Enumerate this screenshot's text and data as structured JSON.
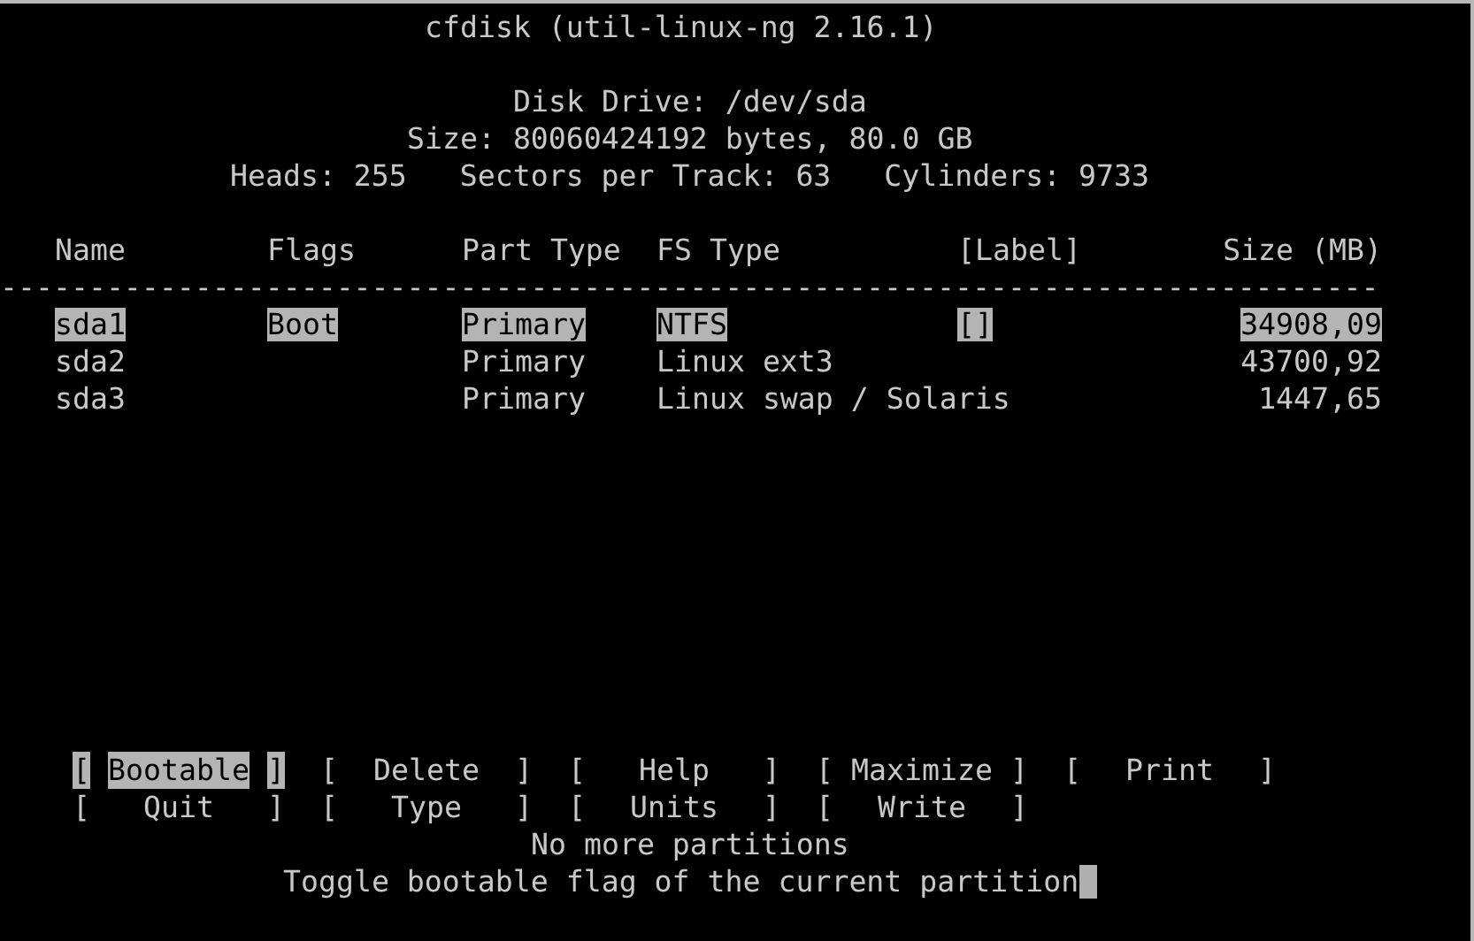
{
  "title": "cfdisk (util-linux-ng 2.16.1)",
  "disk": {
    "drive": "Disk Drive: /dev/sda",
    "size": "Size: 80060424192 bytes, 80.0 GB",
    "geometry": "Heads: 255   Sectors per Track: 63   Cylinders: 9733"
  },
  "table": {
    "columns": [
      "Name",
      "Flags",
      "Part Type",
      "FS Type",
      "[Label]",
      "Size (MB)"
    ],
    "separator": "------------------------------------------------------------------------------",
    "rows": [
      {
        "name": "sda1",
        "flags": "Boot",
        "part_type": "Primary",
        "fs_type": "NTFS",
        "label": "[]",
        "size": "34908,09",
        "selected": true
      },
      {
        "name": "sda2",
        "flags": "",
        "part_type": "Primary",
        "fs_type": "Linux ext3",
        "label": "",
        "size": "43700,92",
        "selected": false
      },
      {
        "name": "sda3",
        "flags": "",
        "part_type": "Primary",
        "fs_type": "Linux swap / Solaris",
        "label": "",
        "size": "1447,65",
        "selected": false
      }
    ]
  },
  "menu": [
    {
      "open": "[",
      "label": "Bootable",
      "close": "]",
      "selected": true
    },
    {
      "open": "[",
      "label": "Delete",
      "close": "]",
      "selected": false
    },
    {
      "open": "[",
      "label": "Help",
      "close": "]",
      "selected": false
    },
    {
      "open": "[",
      "label": "Maximize",
      "close": "]",
      "selected": false
    },
    {
      "open": "[",
      "label": "Print",
      "close": "]",
      "selected": false
    },
    {
      "open": "[",
      "label": "Quit",
      "close": "]",
      "selected": false
    },
    {
      "open": "[",
      "label": "Type",
      "close": "]",
      "selected": false
    },
    {
      "open": "[",
      "label": "Units",
      "close": "]",
      "selected": false
    },
    {
      "open": "[",
      "label": "Write",
      "close": "]",
      "selected": false
    }
  ],
  "status": "No more partitions",
  "help_line": "Toggle bootable flag of the current partition"
}
